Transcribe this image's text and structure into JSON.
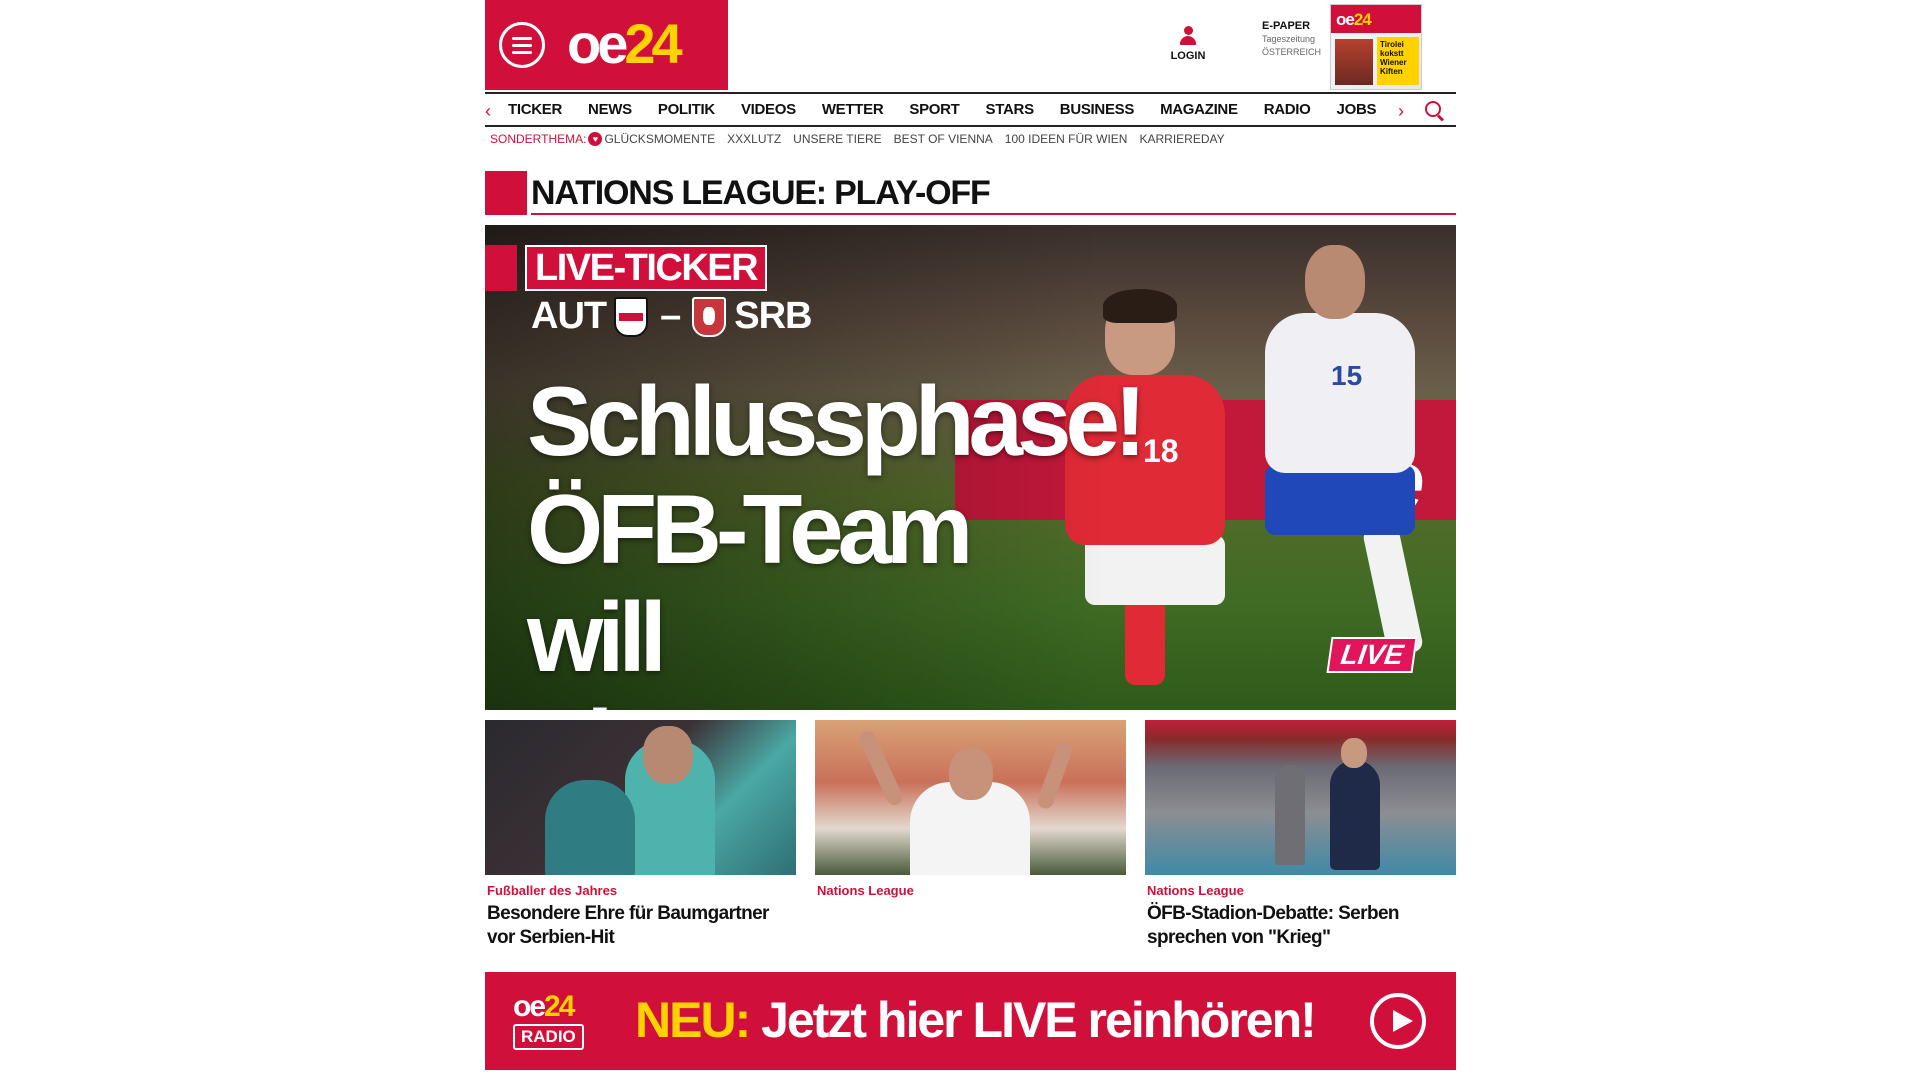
{
  "header": {
    "logo_main": "oe",
    "logo_accent": "24",
    "login_label": "LOGIN",
    "epaper": {
      "title": "E-PAPER",
      "subtitle1": "Tageszeitung",
      "subtitle2": "ÖSTERREICH",
      "cover_headline": "Tirolei kokstt Wiener Kiften"
    }
  },
  "nav": {
    "prev_icon": "‹",
    "next_icon": "›",
    "items": [
      "TICKER",
      "NEWS",
      "POLITIK",
      "VIDEOS",
      "WETTER",
      "SPORT",
      "STARS",
      "BUSINESS",
      "MAGAZINE",
      "RADIO",
      "JOBS"
    ]
  },
  "subnav": {
    "label": "SONDERTHEMA:",
    "items": [
      "GLÜCKSMOMENTE",
      "XXXLUTZ",
      "UNSERE TIERE",
      "BEST OF VIENNA",
      "100 IDEEN FÜR WIEN",
      "KARRIEREDAY"
    ]
  },
  "section": {
    "title": "NATIONS LEAGUE: PLAY-OFF"
  },
  "hero": {
    "ticker_label": "LIVE-TICKER",
    "team_home": "AUT",
    "team_away": "SRB",
    "dash": "–",
    "headline_lines": [
      "Schlussphase!",
      "ÖFB-Team will",
      "Sieg erzwingen"
    ],
    "live_badge": "LIVE",
    "player1_number": "18",
    "player2_number": "15",
    "ad_text": "ue"
  },
  "cards": [
    {
      "kicker": "Fußballer des Jahres",
      "title": "Besondere Ehre für Baumgartner vor Serbien-Hit"
    },
    {
      "kicker": "Nations League",
      "title": ""
    },
    {
      "kicker": "Nations League",
      "title": "ÖFB-Stadion-Debatte: Serben sprechen von \"Krieg\""
    }
  ],
  "radio": {
    "logo_main": "oe",
    "logo_accent": "24",
    "logo_sub": "RADIO",
    "cta_prefix": "NEU:",
    "cta_text": "Jetzt hier LIVE reinhören!"
  },
  "colors": {
    "brand_red": "#d0103a",
    "brand_yellow": "#ffd200"
  }
}
